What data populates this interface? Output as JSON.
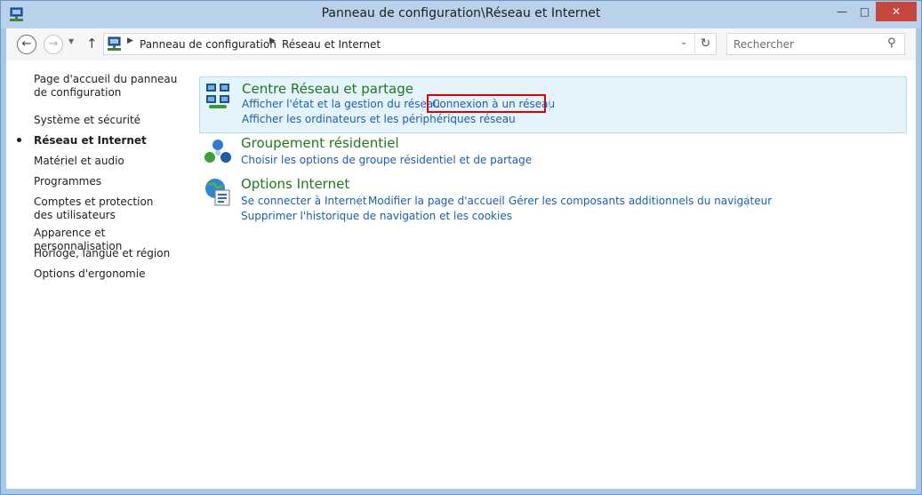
{
  "window": {
    "title": "Panneau de configuration\\Réseau et Internet"
  },
  "address": {
    "crumbs": [
      "Panneau de configuration",
      "Réseau et Internet"
    ],
    "search_placeholder": "Rechercher"
  },
  "sidebar": {
    "home": "Page d'accueil du panneau de configuration",
    "items": [
      "Système et sécurité",
      "Réseau et Internet",
      "Matériel et audio",
      "Programmes",
      "Comptes et protection des utilisateurs",
      "Apparence et personnalisation",
      "Horloge, langue et région",
      "Options d'ergonomie"
    ]
  },
  "categories": [
    {
      "title": "Centre Réseau et partage",
      "links": [
        "Afficher l'état et la gestion du réseau",
        "Connexion à un réseau",
        "Afficher les ordinateurs et les périphériques réseau"
      ]
    },
    {
      "title": "Groupement résidentiel",
      "links": [
        "Choisir les options de groupe résidentiel et de partage"
      ]
    },
    {
      "title": "Options Internet",
      "links": [
        "Se connecter à Internet",
        "Modifier la page d'accueil",
        "Gérer les composants additionnels du navigateur",
        "Supprimer l'historique de navigation et les cookies"
      ]
    }
  ],
  "colors": {
    "accent_link": "#1a5fb4",
    "category_title": "#1e7a1e",
    "highlight": "#e00000"
  }
}
